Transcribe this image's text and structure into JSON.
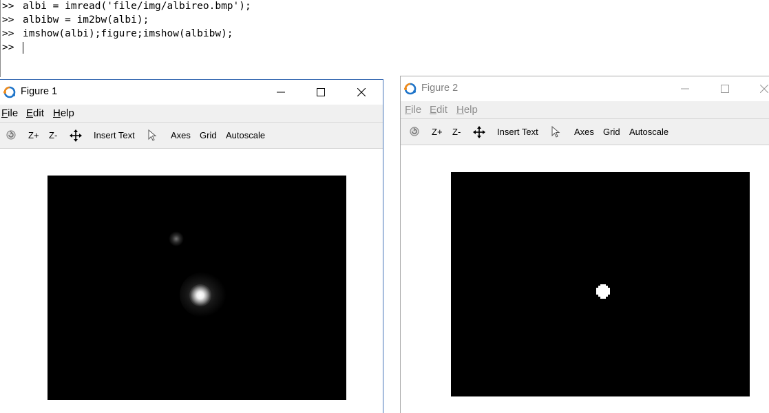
{
  "console": {
    "prompt": ">>",
    "lines": [
      "albi = imread('file/img/albireo.bmp');",
      "albibw = im2bw(albi);",
      "imshow(albi);figure;imshow(albibw);",
      ""
    ]
  },
  "figures": [
    {
      "title": "Figure 1",
      "active": true,
      "menu": [
        {
          "label": "File",
          "accel": "F",
          "rest": "ile"
        },
        {
          "label": "Edit",
          "accel": "E",
          "rest": "dit"
        },
        {
          "label": "Help",
          "accel": "H",
          "rest": "elp"
        }
      ],
      "toolbar": {
        "zoom_in": "Z+",
        "zoom_out": "Z-",
        "insert_text": "Insert Text",
        "axes": "Axes",
        "grid": "Grid",
        "autoscale": "Autoscale"
      }
    },
    {
      "title": "Figure 2",
      "active": false,
      "menu": [
        {
          "label": "File",
          "accel": "F",
          "rest": "ile"
        },
        {
          "label": "Edit",
          "accel": "E",
          "rest": "dit"
        },
        {
          "label": "Help",
          "accel": "H",
          "rest": "elp"
        }
      ],
      "toolbar": {
        "zoom_in": "Z+",
        "zoom_out": "Z-",
        "insert_text": "Insert Text",
        "axes": "Axes",
        "grid": "Grid",
        "autoscale": "Autoscale"
      }
    }
  ],
  "icons": {
    "app": "octave-logo-icon",
    "minimize": "minimize-icon",
    "maximize": "maximize-icon",
    "close": "close-icon",
    "rotate": "rotate-icon",
    "pan": "pan-icon",
    "select": "select-pointer-icon"
  },
  "colors": {
    "active_border": "#3f6fb5",
    "inactive_text": "#808080",
    "toolbar_bg": "#f0f0f0",
    "plot_bg": "#000000"
  }
}
